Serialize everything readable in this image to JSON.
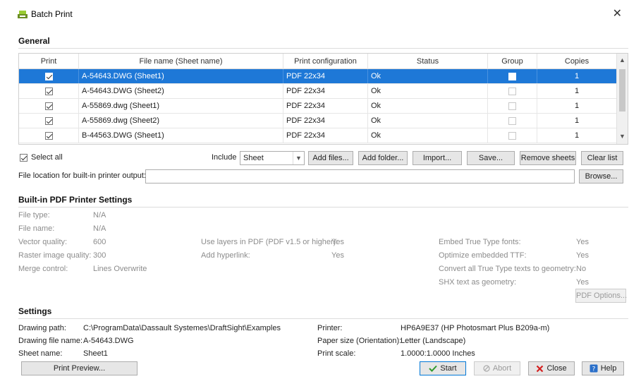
{
  "window": {
    "title": "Batch Print"
  },
  "general": {
    "title": "General",
    "columns": [
      "Print",
      "File name (Sheet name)",
      "Print configuration",
      "Status",
      "Group",
      "Copies"
    ],
    "rows": [
      {
        "print": true,
        "file": "A-54643.DWG (Sheet1)",
        "config": "PDF 22x34",
        "status": "Ok",
        "group": false,
        "copies": "1",
        "selected": true
      },
      {
        "print": true,
        "file": "A-54643.DWG (Sheet2)",
        "config": "PDF 22x34",
        "status": "Ok",
        "group": false,
        "copies": "1",
        "selected": false
      },
      {
        "print": true,
        "file": "A-55869.dwg (Sheet1)",
        "config": "PDF 22x34",
        "status": "Ok",
        "group": false,
        "copies": "1",
        "selected": false
      },
      {
        "print": true,
        "file": "A-55869.dwg (Sheet2)",
        "config": "PDF 22x34",
        "status": "Ok",
        "group": false,
        "copies": "1",
        "selected": false
      },
      {
        "print": true,
        "file": "B-44563.DWG (Sheet1)",
        "config": "PDF 22x34",
        "status": "Ok",
        "group": false,
        "copies": "1",
        "selected": false
      }
    ],
    "select_all_label": "Select all",
    "select_all_checked": true,
    "include_label": "Include",
    "include_value": "Sheet",
    "buttons": {
      "add_files": "Add files...",
      "add_folder": "Add folder...",
      "import": "Import...",
      "save": "Save...",
      "remove_sheets": "Remove sheets",
      "clear_list": "Clear list"
    },
    "file_location_label": "File location for built-in printer output:",
    "file_location_value": "",
    "browse_label": "Browse..."
  },
  "pdf_settings": {
    "title": "Built-in PDF Printer Settings",
    "file_type_label": "File type:",
    "file_type_value": "N/A",
    "file_name_label": "File name:",
    "file_name_value": "N/A",
    "vector_quality_label": "Vector quality:",
    "vector_quality_value": "600",
    "raster_quality_label": "Raster image quality:",
    "raster_quality_value": "300",
    "merge_control_label": "Merge control:",
    "merge_control_value": "Lines Overwrite",
    "use_layers_label": "Use layers in PDF (PDF v1.5 or higher):",
    "use_layers_value": "Yes",
    "add_hyperlink_label": "Add hyperlink:",
    "add_hyperlink_value": "Yes",
    "embed_fonts_label": "Embed True Type fonts:",
    "embed_fonts_value": "Yes",
    "optimize_ttf_label": "Optimize embedded TTF:",
    "optimize_ttf_value": "Yes",
    "convert_tt_label": "Convert all True Type texts to geometry:",
    "convert_tt_value": "No",
    "shx_label": "SHX text as geometry:",
    "shx_value": "Yes",
    "pdf_options_label": "PDF Options..."
  },
  "settings": {
    "title": "Settings",
    "drawing_path_label": "Drawing path:",
    "drawing_path_value": "C:\\ProgramData\\Dassault Systemes\\DraftSight\\Examples",
    "drawing_file_label": "Drawing file name:",
    "drawing_file_value": "A-54643.DWG",
    "sheet_name_label": "Sheet name:",
    "sheet_name_value": "Sheet1",
    "printer_label": "Printer:",
    "printer_value": "HP6A9E37 (HP Photosmart Plus B209a-m)",
    "paper_size_label": "Paper size (Orientation):",
    "paper_size_value": "Letter (Landscape)",
    "print_scale_label": "Print scale:",
    "print_scale_value": "1.0000:1.0000 Inches"
  },
  "footer": {
    "print_preview": "Print Preview...",
    "start": "Start",
    "abort": "Abort",
    "close": "Close",
    "help": "Help"
  },
  "colors": {
    "selection": "#1e78d7",
    "start_check": "#2e9a2e",
    "close_x": "#d42020",
    "help_icon": "#2a6fc9"
  }
}
